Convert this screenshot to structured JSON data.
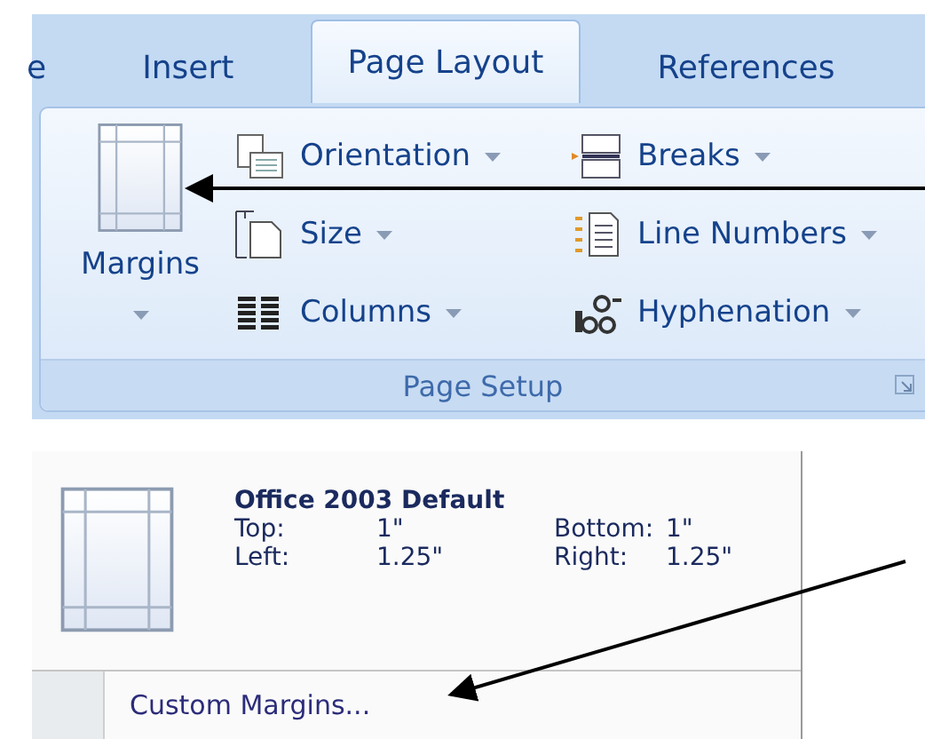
{
  "tabs": [
    {
      "label": "e",
      "selected": false
    },
    {
      "label": "Insert",
      "selected": false
    },
    {
      "label": "Page Layout",
      "selected": true
    },
    {
      "label": "References",
      "selected": false
    }
  ],
  "page_setup_group": {
    "title": "Page Setup",
    "large_button": {
      "label": "Margins"
    },
    "columns": [
      [
        {
          "label": "Orientation",
          "kind": "orientation"
        },
        {
          "label": "Size",
          "kind": "size"
        },
        {
          "label": "Columns",
          "kind": "columns"
        }
      ],
      [
        {
          "label": "Breaks",
          "kind": "breaks"
        },
        {
          "label": "Line Numbers",
          "kind": "line-numbers"
        },
        {
          "label": "Hyphenation",
          "kind": "hyphenation"
        }
      ]
    ]
  },
  "margins_menu": {
    "preset": {
      "name": "Office 2003 Default",
      "fields": [
        {
          "label": "Top:",
          "value": "1\""
        },
        {
          "label": "Bottom:",
          "value": "1\""
        },
        {
          "label": "Left:",
          "value": "1.25\""
        },
        {
          "label": "Right:",
          "value": "1.25\""
        }
      ]
    },
    "custom_item": "Custom Margins..."
  }
}
